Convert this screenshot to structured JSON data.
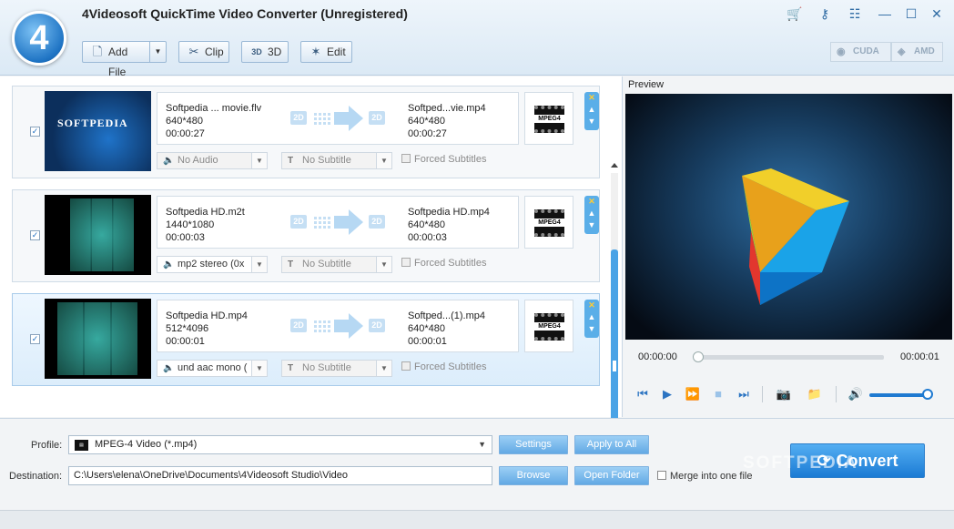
{
  "window": {
    "title": "4Videosoft QuickTime Video Converter (Unregistered)",
    "logo_text": "4"
  },
  "toolbar": {
    "add_file": "Add File",
    "clip": "Clip",
    "three_d": "3D",
    "edit": "Edit",
    "cuda": "CUDA",
    "amd": "AMD"
  },
  "files": [
    {
      "checked": true,
      "src_name": "Softpedia ... movie.flv",
      "src_res": "640*480",
      "src_dur": "00:00:27",
      "dst_name": "Softped...vie.mp4",
      "dst_res": "640*480",
      "dst_dur": "00:00:27",
      "audio": "No Audio",
      "subtitle": "No Subtitle",
      "forced": "Forced Subtitles",
      "badge_in": "2D",
      "badge_out": "2D",
      "fmt": "MPEG4",
      "thumb_text": "SOFTPEDIA"
    },
    {
      "checked": true,
      "src_name": "Softpedia HD.m2t",
      "src_res": "1440*1080",
      "src_dur": "00:00:03",
      "dst_name": "Softpedia HD.mp4",
      "dst_res": "640*480",
      "dst_dur": "00:00:03",
      "audio": "mp2 stereo (0x",
      "subtitle": "No Subtitle",
      "forced": "Forced Subtitles",
      "badge_in": "2D",
      "badge_out": "2D",
      "fmt": "MPEG4"
    },
    {
      "checked": true,
      "src_name": "Softpedia HD.mp4",
      "src_res": "512*4096",
      "src_dur": "00:00:01",
      "dst_name": "Softped...(1).mp4",
      "dst_res": "640*480",
      "dst_dur": "00:00:01",
      "audio": "und aac mono (",
      "subtitle": "No Subtitle",
      "forced": "Forced Subtitles",
      "badge_in": "2D",
      "badge_out": "2D",
      "fmt": "MPEG4"
    }
  ],
  "preview": {
    "label": "Preview",
    "time_current": "00:00:00",
    "time_total": "00:00:01",
    "progress": 0.0,
    "volume": 0.95
  },
  "bottom": {
    "profile_label": "Profile:",
    "profile_value": "MPEG-4 Video (*.mp4)",
    "settings": "Settings",
    "apply_all": "Apply to All",
    "destination_label": "Destination:",
    "destination_value": "C:\\Users\\elena\\OneDrive\\Documents\\4Videosoft Studio\\Video",
    "browse": "Browse",
    "open_folder": "Open Folder",
    "merge": "Merge into one file",
    "convert": "Convert",
    "watermark": "SOFTPEDIA"
  },
  "colors": {
    "accent": "#1f7ad1",
    "title_bg": "#dbe9f5",
    "selected_row": "#dcedfb",
    "button_blue": "#62a9e4"
  }
}
